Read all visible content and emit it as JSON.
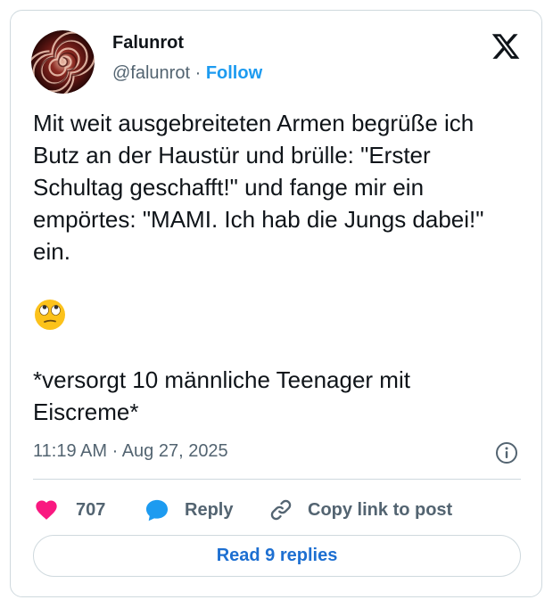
{
  "author": {
    "name": "Falunrot",
    "handle": "@falunrot",
    "separator": "·",
    "follow_label": "Follow",
    "avatar_icon": "spiral-avatar-icon"
  },
  "brand": {
    "logo_icon": "x-logo-icon"
  },
  "tweet": {
    "paragraph_1": "Mit weit ausgebreiteten Armen begrüße ich Butz an der Haustür und brülle: \"Erster Schultag geschafft!\" und fange mir ein empörtes: \"MAMI. Ich hab die Jungs dabei!\" ein.",
    "emoji_icon": "face-with-rolling-eyes-emoji",
    "paragraph_2": "*versorgt 10 männliche Teenager mit Eiscreme*",
    "timestamp": "11:19 AM · Aug 27, 2025"
  },
  "actions": {
    "like_count": "707",
    "reply_label": "Reply",
    "copy_label": "Copy link to post"
  },
  "footer": {
    "read_replies_label": "Read 9 replies"
  },
  "colors": {
    "accent": "#1d9bf0",
    "like": "#f91880",
    "text": "#0f1419",
    "muted": "#536471",
    "border": "#cfd9de"
  }
}
